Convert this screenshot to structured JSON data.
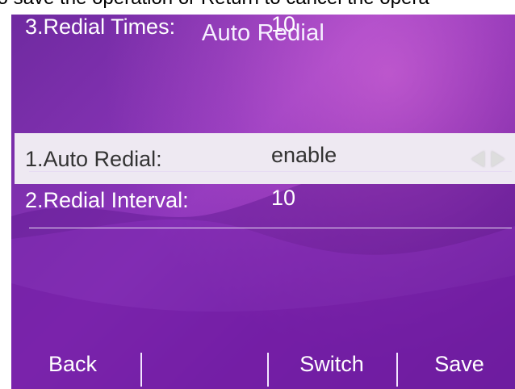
{
  "instruction": {
    "text": "to save the operation or Return to cancel the opera"
  },
  "screen": {
    "title": "Auto Redial",
    "items": [
      {
        "label": "1.Auto Redial:",
        "value": "enable",
        "selected": true
      },
      {
        "label": "2.Redial Interval:",
        "value": "10",
        "selected": false
      },
      {
        "label": "3.Redial Times:",
        "value": "10",
        "selected": false
      }
    ],
    "softkeys": [
      "Back",
      "",
      "Switch",
      "Save"
    ]
  },
  "colors": {
    "screen_background": "#7f2eaf",
    "selection_background": "#eee9f2",
    "text_light": "#ffffff",
    "text_dark": "#333333"
  },
  "icons": {
    "selector": "left-right-arrows"
  }
}
